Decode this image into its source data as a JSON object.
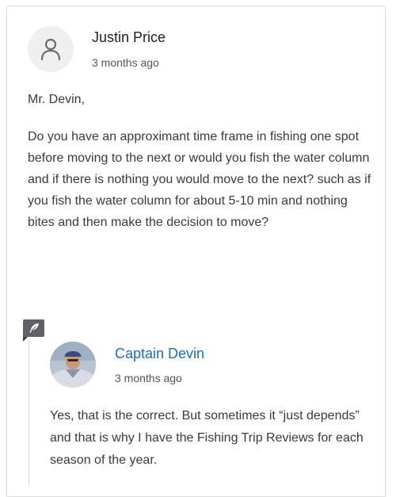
{
  "comment": {
    "author": "Justin Price",
    "timestamp": "3 months ago",
    "greeting": "Mr. Devin,",
    "body": "Do you have an approximant time frame in fishing one spot before moving to the next or would you fish the water column and if there is nothing you would move to the next? such as if you fish the water column for about 5-10 min and nothing bites and then make the decision to move?"
  },
  "reply": {
    "author": "Captain Devin",
    "timestamp": "3 months ago",
    "body": "Yes, that is the correct. But sometimes it “just depends” and that is why I have the Fishing Trip Reviews for each season of the year."
  },
  "colors": {
    "reply_author": "#1e6eb8",
    "badge": "#5f6166",
    "text": "#3a3a3a"
  },
  "icons": {
    "default_avatar": "user-icon",
    "reply_badge": "feather-quill-icon"
  }
}
